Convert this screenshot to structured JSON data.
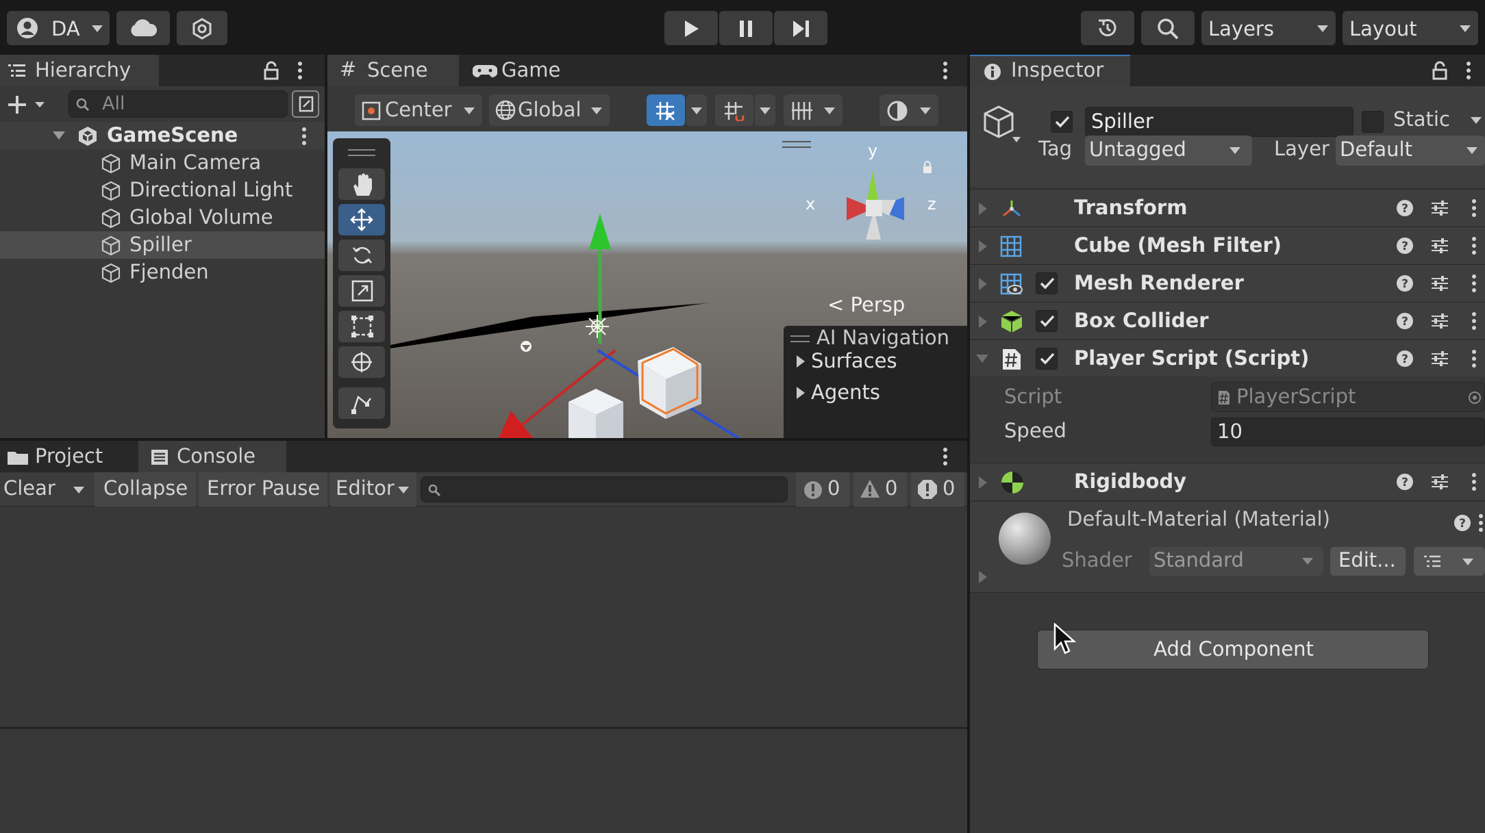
{
  "toolbar": {
    "account_label": "DA",
    "layers_label": "Layers",
    "layout_label": "Layout"
  },
  "hierarchy": {
    "tab_label": "Hierarchy",
    "search_placeholder": "All",
    "scene_name": "GameScene",
    "items": [
      "Main Camera",
      "Directional Light",
      "Global Volume",
      "Spiller",
      "Fjenden"
    ]
  },
  "scene_view": {
    "tabs": [
      "Scene",
      "Game"
    ],
    "pivot_label": "Center",
    "space_label": "Global",
    "persp_label": "Persp",
    "gizmo_axes": [
      "y",
      "x",
      "z"
    ],
    "overlay": {
      "title": "AI Navigation",
      "items": [
        "Surfaces",
        "Agents"
      ]
    }
  },
  "console": {
    "tabs": [
      "Project",
      "Console"
    ],
    "clear_label": "Clear",
    "collapse_label": "Collapse",
    "error_pause_label": "Error Pause",
    "editor_label": "Editor",
    "counts": {
      "info": "0",
      "warnings": "0",
      "errors": "0"
    }
  },
  "inspector": {
    "tab_label": "Inspector",
    "object_name": "Spiller",
    "static_label": "Static",
    "tag_label": "Tag",
    "tag_value": "Untagged",
    "layer_label": "Layer",
    "layer_value": "Default",
    "components": [
      "Transform",
      "Cube (Mesh Filter)",
      "Mesh Renderer",
      "Box Collider",
      "Player Script (Script)",
      "Rigidbody"
    ],
    "script_field_label": "Script",
    "script_field_value": "PlayerScript",
    "speed_label": "Speed",
    "speed_value": "10",
    "material_name": "Default-Material (Material)",
    "shader_label": "Shader",
    "shader_value": "Standard",
    "edit_label": "Edit...",
    "add_component_label": "Add Component"
  },
  "colors": {
    "accent": "#3a79bb",
    "panel": "#383838",
    "toolbar": "#191919"
  }
}
